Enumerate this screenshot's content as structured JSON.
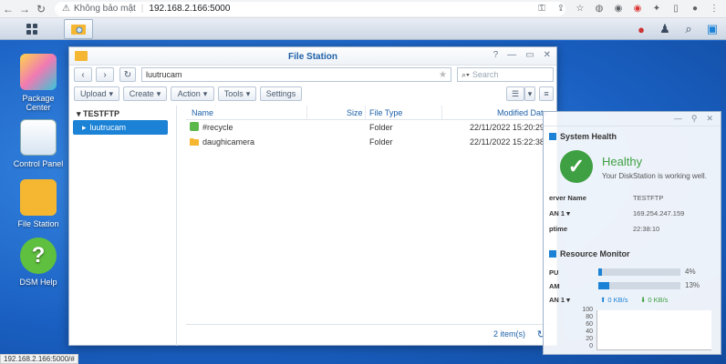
{
  "browser": {
    "security_label": "Không bảo mật",
    "url": "192.168.2.166:5000"
  },
  "desktop": {
    "icons": [
      {
        "label": "Package\nCenter"
      },
      {
        "label": "Control Panel"
      },
      {
        "label": "File Station"
      },
      {
        "label": "DSM Help"
      }
    ]
  },
  "file_station": {
    "title": "File Station",
    "path": "luutrucam",
    "search_placeholder": "Search",
    "actions": {
      "upload": "Upload",
      "create": "Create",
      "action": "Action",
      "tools": "Tools",
      "settings": "Settings"
    },
    "tree": {
      "root": "TESTFTP",
      "selected": "luutrucam"
    },
    "columns": {
      "name": "Name",
      "size": "Size",
      "type": "File Type",
      "modified": "Modified Date"
    },
    "rows": [
      {
        "name": "#recycle",
        "size": "",
        "type": "Folder",
        "modified": "22/11/2022 15:20:29"
      },
      {
        "name": "daughicamera",
        "size": "",
        "type": "Folder",
        "modified": "22/11/2022 15:22:38"
      }
    ],
    "item_count": "2 item(s)"
  },
  "system_health": {
    "title": "System Health",
    "status": "Healthy",
    "subtitle": "Your DiskStation is working well.",
    "server_name_label": "erver Name",
    "server_name_value": "TESTFTP",
    "lan_label": "AN 1",
    "lan_value": "169.254.247.159",
    "uptime_label": "ptime",
    "uptime_value": "22:38:10"
  },
  "resource_monitor": {
    "title": "Resource Monitor",
    "cpu_label": "PU",
    "cpu_value": "4%",
    "cpu_fraction": 0.04,
    "ram_label": "AM",
    "ram_value": "13%",
    "ram_fraction": 0.13,
    "lan_label": "AN 1",
    "upload_rate": "0 KB/s",
    "download_rate": "0 KB/s",
    "y_ticks": [
      "100",
      "80",
      "60",
      "40",
      "20",
      "0"
    ]
  },
  "status_bar_url": "192.168.2.166:5000/#"
}
